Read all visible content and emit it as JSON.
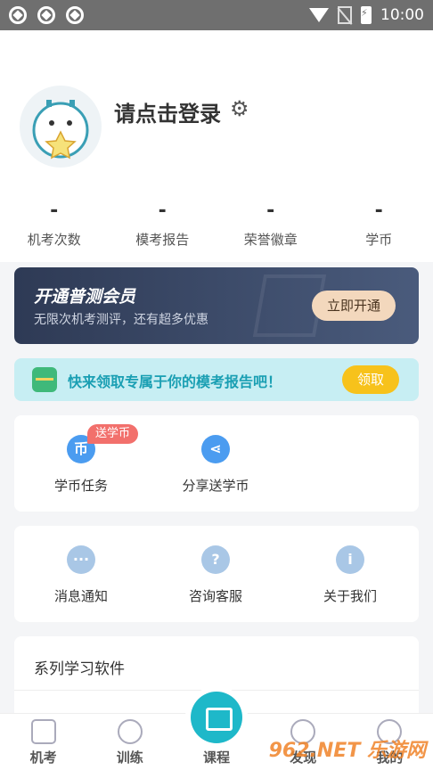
{
  "status_bar": {
    "time": "10:00"
  },
  "profile": {
    "login_text": "请点击登录"
  },
  "stats": [
    {
      "value": "-",
      "label": "机考次数"
    },
    {
      "value": "-",
      "label": "模考报告"
    },
    {
      "value": "-",
      "label": "荣誉徽章"
    },
    {
      "value": "-",
      "label": "学币"
    }
  ],
  "vip_banner": {
    "title": "开通普测会员",
    "subtitle": "无限次机考测评，还有超多优惠",
    "button": "立即开通"
  },
  "promo": {
    "text": "快来领取专属于你的模考报告吧！",
    "button": "领取"
  },
  "card1": {
    "badge": "送学币",
    "items": [
      {
        "label": "学币任务",
        "icon": "coin-icon",
        "glyph": "币"
      },
      {
        "label": "分享送学币",
        "icon": "share-icon",
        "glyph": "⋖"
      }
    ]
  },
  "card2": {
    "items": [
      {
        "label": "消息通知",
        "icon": "message-icon",
        "glyph": "···"
      },
      {
        "label": "咨询客服",
        "icon": "help-icon",
        "glyph": "?"
      },
      {
        "label": "关于我们",
        "icon": "info-icon",
        "glyph": "i"
      }
    ]
  },
  "card3": {
    "title": "系列学习软件"
  },
  "tabbar": {
    "tabs": [
      {
        "label": "机考"
      },
      {
        "label": "训练"
      },
      {
        "label": "课程"
      },
      {
        "label": "发现"
      },
      {
        "label": "我的"
      }
    ]
  },
  "watermark": "962.NET 乐游网",
  "colors": {
    "accent": "#1eb8c9",
    "vip_bg": "#2e3a55",
    "promo_bg": "#c7eef3",
    "badge": "#f2706c",
    "promo_button": "#f7c21b"
  }
}
